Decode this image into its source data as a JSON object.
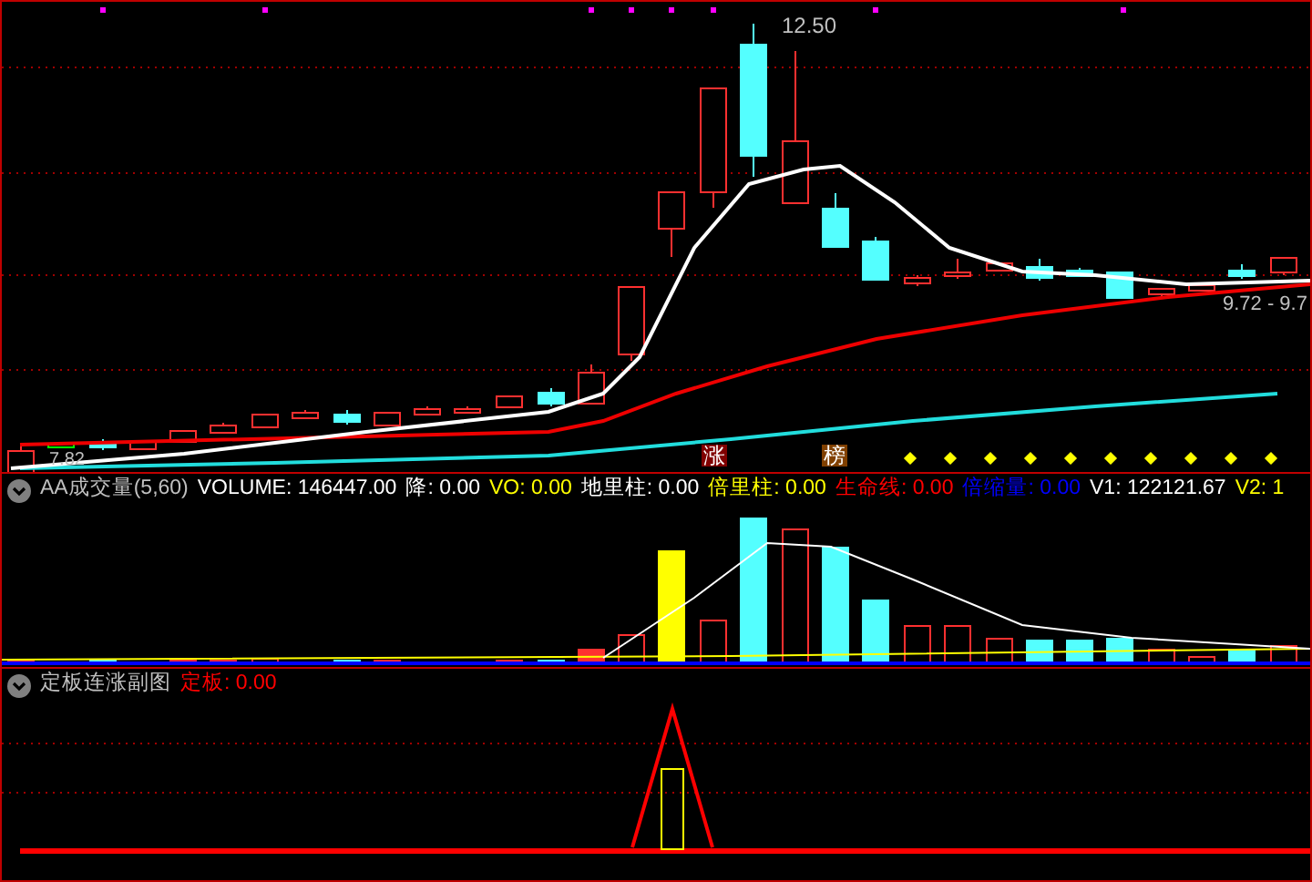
{
  "main_chart": {
    "price_labels": [
      {
        "kind": "high",
        "text": "12.50"
      },
      {
        "kind": "low",
        "text": "7.82"
      },
      {
        "kind": "last",
        "text": "9.72 - 9.7"
      }
    ],
    "markers": [
      {
        "text": "涨"
      },
      {
        "text": "榜"
      }
    ]
  },
  "volume_panel": {
    "legend": [
      {
        "text": "AA成交量(5,60)",
        "color": "#c0c0c0"
      },
      {
        "text": "VOLUME: 146447.00",
        "color": "#ffffff"
      },
      {
        "text": "降: 0.00",
        "color": "#ffffff"
      },
      {
        "text": "VO: 0.00",
        "color": "#ffff00"
      },
      {
        "text": "地里柱: 0.00",
        "color": "#ffffff"
      },
      {
        "text": "倍里柱: 0.00",
        "color": "#ffff00"
      },
      {
        "text": "生命线: 0.00",
        "color": "#ff0000"
      },
      {
        "text": "倍缩量: 0.00",
        "color": "#0000ff"
      },
      {
        "text": "V1: 122121.67",
        "color": "#ffffff"
      },
      {
        "text": "V2: 1",
        "color": "#ffff00"
      }
    ]
  },
  "limit_panel": {
    "legend": [
      {
        "text": "定板连涨副图",
        "color": "#c0c0c0"
      },
      {
        "text": "定板: 0.00",
        "color": "#ff0000"
      }
    ]
  }
}
